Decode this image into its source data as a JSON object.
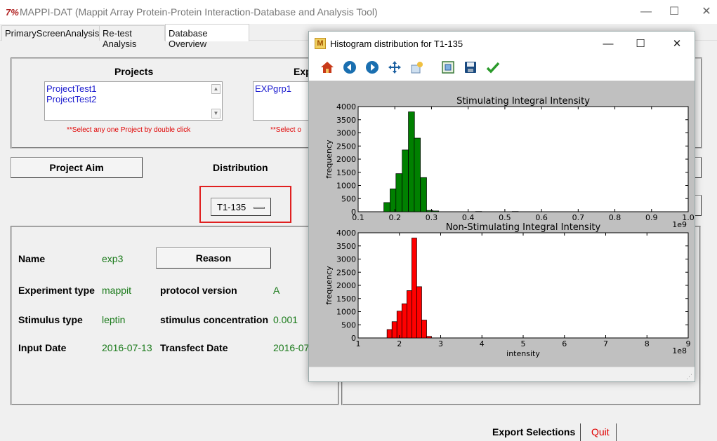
{
  "window": {
    "title": "MAPPI-DAT (Mappit Array Protein-Protein Interaction-Database and Analysis Tool)",
    "icon_text": "7%",
    "minimize": "—",
    "maximize": "☐",
    "close": "✕"
  },
  "tabs": [
    {
      "label": "PrimaryScreenAnalysis"
    },
    {
      "label": "Re-test Analysis"
    },
    {
      "label": "Database Overview"
    }
  ],
  "projects": {
    "header": "Projects",
    "items": [
      "ProjectTest1",
      "ProjectTest2"
    ],
    "hint": "**Select any one Project by double click"
  },
  "experiments": {
    "header": "Exp",
    "items": [
      "EXPgrp1"
    ],
    "hint": "**Select o"
  },
  "project_aim_button": "Project Aim",
  "distribution": {
    "label": "Distribution",
    "selected": "T1-135"
  },
  "details": {
    "name_label": "Name",
    "name_value": "exp3",
    "reason_button": "Reason",
    "experiment_type_label": "Experiment type",
    "experiment_type_value": "mappit",
    "protocol_version_label": "protocol version",
    "protocol_version_value": "A",
    "stimulus_type_label": "Stimulus type",
    "stimulus_type_value": "leptin",
    "stimulus_concentration_label": "stimulus concentration",
    "stimulus_concentration_value": "0.001",
    "input_date_label": "Input Date",
    "input_date_value": "2016-07-13",
    "transfect_date_label": "Transfect Date",
    "transfect_date_value": "2016-07"
  },
  "footer": {
    "export_button": "Export Selections",
    "quit_button": "Quit"
  },
  "popup": {
    "title": "Histogram distribution for T1-135",
    "icon_text": "M",
    "minimize": "—",
    "maximize": "☐",
    "close": "✕",
    "toolbar": {
      "home_icon": "home-icon",
      "back_icon": "back-arrow-icon",
      "forward_icon": "forward-arrow-icon",
      "pan_icon": "pan-move-icon",
      "zoom_icon": "zoom-icon",
      "subplots_icon": "configure-subplots-icon",
      "save_icon": "save-icon",
      "edit_icon": "edit-axes-icon"
    }
  },
  "colors": {
    "green_bars": "#008000",
    "red_bars": "#ff0000",
    "highlight_border": "#e02020",
    "link_blue": "#1c1ccf",
    "value_green": "#1a7a1a"
  },
  "chart_data": [
    {
      "type": "bar",
      "title": "Stimulating Integral Intensity",
      "ylabel": "frequency",
      "xlabel": "",
      "offset_label": "1e9",
      "xlim": [
        0.1,
        1.0
      ],
      "ylim": [
        0,
        4000
      ],
      "xticks": [
        "0.1",
        "0.2",
        "0.3",
        "0.4",
        "0.5",
        "0.6",
        "0.7",
        "0.8",
        "0.9",
        "1.0"
      ],
      "yticks": [
        "0",
        "500",
        "1000",
        "1500",
        "2000",
        "2500",
        "3000",
        "3500",
        "4000"
      ],
      "bin_width": 0.0167,
      "bins": [
        {
          "x": 0.17,
          "value": 350
        },
        {
          "x": 0.187,
          "value": 870
        },
        {
          "x": 0.203,
          "value": 1450
        },
        {
          "x": 0.22,
          "value": 2350
        },
        {
          "x": 0.237,
          "value": 3800
        },
        {
          "x": 0.253,
          "value": 2800
        },
        {
          "x": 0.27,
          "value": 1300
        },
        {
          "x": 0.287,
          "value": 50
        },
        {
          "x": 0.303,
          "value": 30
        },
        {
          "x": 0.42,
          "value": 10
        },
        {
          "x": 0.52,
          "value": 10
        }
      ]
    },
    {
      "type": "bar",
      "title": "Non-Stimulating Integral Intensity",
      "ylabel": "frequency",
      "xlabel": "intensity",
      "offset_label": "1e8",
      "xlim": [
        1,
        9
      ],
      "ylim": [
        0,
        4000
      ],
      "xticks": [
        "1",
        "2",
        "3",
        "4",
        "5",
        "6",
        "7",
        "8",
        "9"
      ],
      "yticks": [
        "0",
        "500",
        "1000",
        "1500",
        "2000",
        "2500",
        "3000",
        "3500",
        "4000"
      ],
      "bin_width": 0.12,
      "bins": [
        {
          "x": 1.7,
          "value": 320
        },
        {
          "x": 1.82,
          "value": 620
        },
        {
          "x": 1.94,
          "value": 1020
        },
        {
          "x": 2.06,
          "value": 1300
        },
        {
          "x": 2.18,
          "value": 1800
        },
        {
          "x": 2.3,
          "value": 3800
        },
        {
          "x": 2.42,
          "value": 1950
        },
        {
          "x": 2.54,
          "value": 680
        },
        {
          "x": 2.66,
          "value": 60
        }
      ]
    }
  ]
}
